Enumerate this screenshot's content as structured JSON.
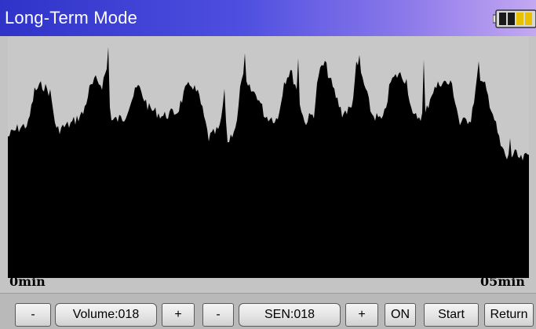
{
  "header": {
    "title": "Long-Term Mode",
    "battery_icon": "battery-icon",
    "battery_colors": [
      "#1a1a1a",
      "#e8c200"
    ]
  },
  "plot": {
    "x_start_label": "0min",
    "x_end_label": "05min",
    "fill_color": "#000000",
    "background_color": "#c8c8c8"
  },
  "toolbar": {
    "volume_minus": "-",
    "volume_value": "Volume:018",
    "volume_plus": "+",
    "sen_minus": "-",
    "sen_value": "SEN:018",
    "sen_plus": "+",
    "on_label": "ON",
    "start_label": "Start",
    "return_label": "Return"
  }
}
